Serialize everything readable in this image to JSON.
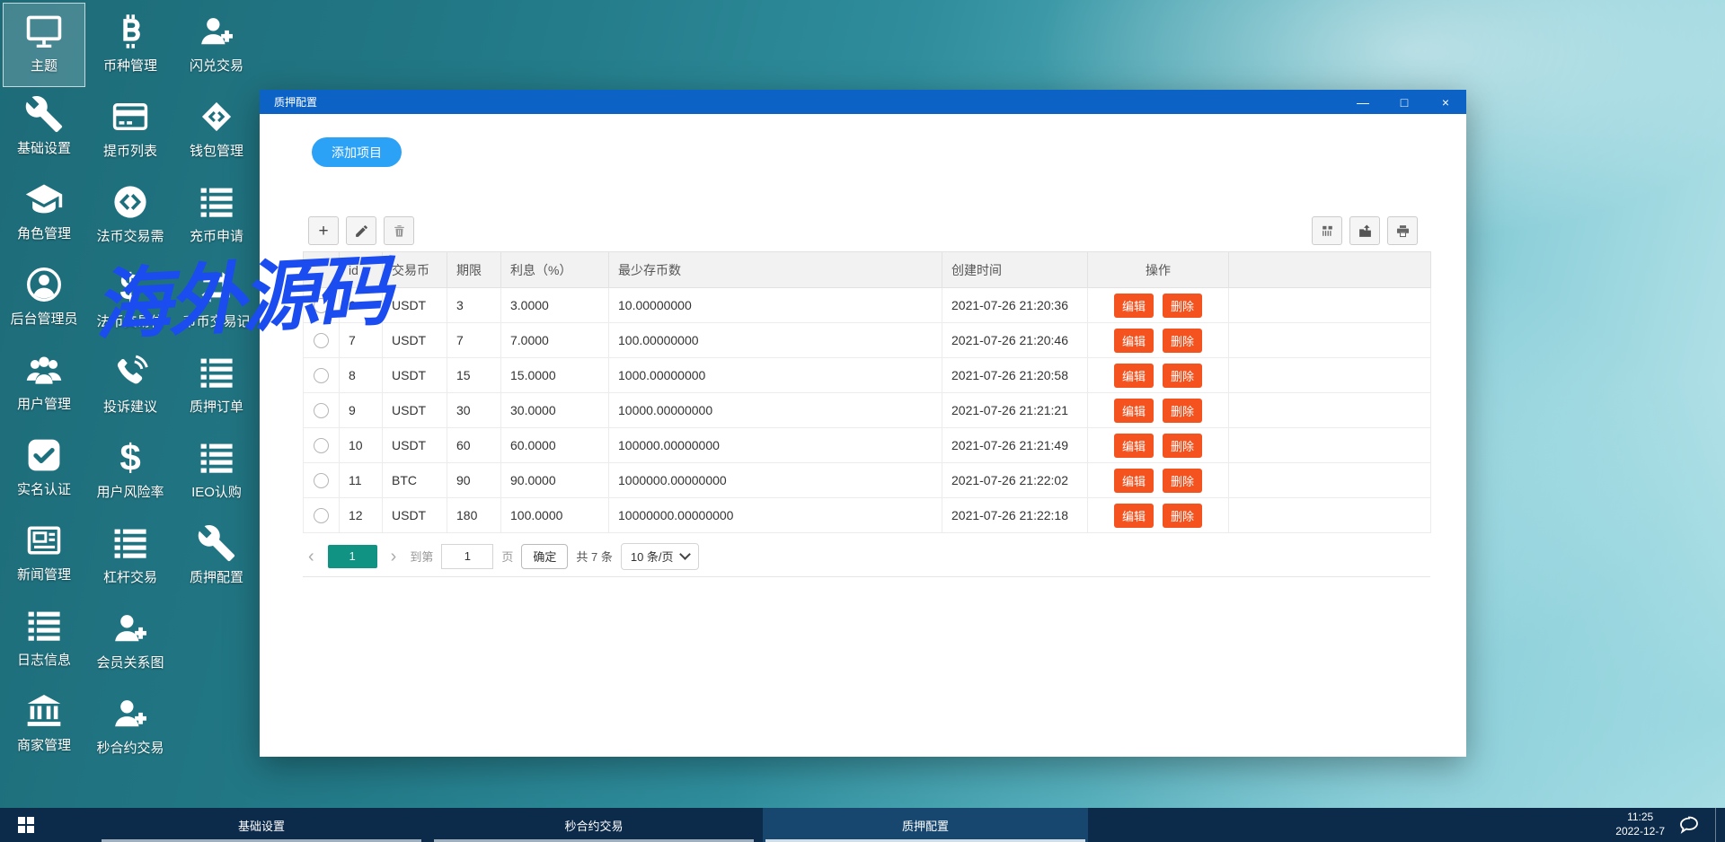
{
  "watermark": "海外源码",
  "colors": {
    "titlebar": "#0d63c5",
    "add_button": "#2ba2f5",
    "action_button": "#f4521e",
    "pager_active": "#109383",
    "taskbar": "#0c2a4a"
  },
  "desktop": {
    "columns": [
      [
        {
          "label": "主题",
          "icon": "monitor-icon",
          "selected": true
        },
        {
          "label": "基础设置",
          "icon": "wrench-icon"
        },
        {
          "label": "角色管理",
          "icon": "graduation-cap-icon"
        },
        {
          "label": "后台管理员",
          "icon": "user-circle-icon"
        },
        {
          "label": "用户管理",
          "icon": "users-icon"
        },
        {
          "label": "实名认证",
          "icon": "check-square-icon"
        },
        {
          "label": "新闻管理",
          "icon": "newspaper-icon"
        },
        {
          "label": "日志信息",
          "icon": "list-icon"
        },
        {
          "label": "商家管理",
          "icon": "bank-icon"
        }
      ],
      [
        {
          "label": "币种管理",
          "icon": "bitcoin-icon"
        },
        {
          "label": "提币列表",
          "icon": "credit-card-icon"
        },
        {
          "label": "法币交易需",
          "icon": "emblem-icon"
        },
        {
          "label": "法币交易信",
          "icon": "dollar-icon"
        },
        {
          "label": "投诉建议",
          "icon": "phone-icon"
        },
        {
          "label": "用户风险率",
          "icon": "dollar-icon"
        },
        {
          "label": "杠杆交易",
          "icon": "list-icon"
        },
        {
          "label": "会员关系图",
          "icon": "user-plus-icon"
        },
        {
          "label": "秒合约交易",
          "icon": "user-plus-icon"
        }
      ],
      [
        {
          "label": "闪兑交易",
          "icon": "user-plus-icon"
        },
        {
          "label": "钱包管理",
          "icon": "gem-icon"
        },
        {
          "label": "充币申请",
          "icon": "list-icon"
        },
        {
          "label": "币币交易记",
          "icon": "exchange-icon"
        },
        {
          "label": "质押订单",
          "icon": "list-icon"
        },
        {
          "label": "IEO认购",
          "icon": "list-icon"
        },
        {
          "label": "质押配置",
          "icon": "wrench-icon"
        }
      ]
    ]
  },
  "window": {
    "title": "质押配置",
    "controls": {
      "minimize": "—",
      "maximize": "□",
      "close": "×"
    },
    "add_button": "添加项目",
    "toolbar": {
      "left": [
        "add-row-icon",
        "edit-row-icon",
        "delete-row-icon"
      ],
      "right": [
        "columns-icon",
        "export-icon",
        "print-icon"
      ]
    },
    "table": {
      "headers": [
        "id",
        "交易币",
        "期限",
        "利息（%）",
        "最少存币数",
        "创建时间",
        "操作"
      ],
      "edit_label": "编辑",
      "delete_label": "删除",
      "rows": [
        {
          "id": "6",
          "coin": "USDT",
          "term": "3",
          "interest": "3.0000",
          "min": "10.00000000",
          "created": "2021-07-26 21:20:36"
        },
        {
          "id": "7",
          "coin": "USDT",
          "term": "7",
          "interest": "7.0000",
          "min": "100.00000000",
          "created": "2021-07-26 21:20:46"
        },
        {
          "id": "8",
          "coin": "USDT",
          "term": "15",
          "interest": "15.0000",
          "min": "1000.00000000",
          "created": "2021-07-26 21:20:58"
        },
        {
          "id": "9",
          "coin": "USDT",
          "term": "30",
          "interest": "30.0000",
          "min": "10000.00000000",
          "created": "2021-07-26 21:21:21"
        },
        {
          "id": "10",
          "coin": "USDT",
          "term": "60",
          "interest": "60.0000",
          "min": "100000.00000000",
          "created": "2021-07-26 21:21:49"
        },
        {
          "id": "11",
          "coin": "BTC",
          "term": "90",
          "interest": "90.0000",
          "min": "1000000.00000000",
          "created": "2021-07-26 21:22:02"
        },
        {
          "id": "12",
          "coin": "USDT",
          "term": "180",
          "interest": "100.0000",
          "min": "10000000.00000000",
          "created": "2021-07-26 21:22:18"
        }
      ]
    },
    "pagination": {
      "prev": "‹",
      "next": "›",
      "page": "1",
      "goto_prefix": "到第",
      "goto_value": "1",
      "goto_suffix": "页",
      "confirm": "确定",
      "total": "共 7 条",
      "page_size": "10 条/页"
    }
  },
  "taskbar": {
    "items": [
      {
        "label": "基础设置",
        "active": false
      },
      {
        "label": "秒合约交易",
        "active": false
      },
      {
        "label": "质押配置",
        "active": true
      }
    ],
    "clock": {
      "time": "11:25",
      "date": "2022-12-7"
    }
  }
}
